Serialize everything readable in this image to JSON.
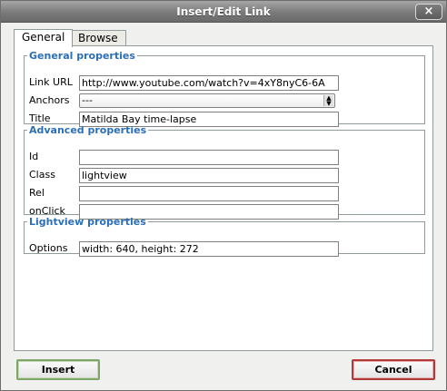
{
  "window": {
    "title": "Insert/Edit Link",
    "close_icon": "×"
  },
  "tabs": [
    {
      "label": "General",
      "active": true
    },
    {
      "label": "Browse",
      "active": false
    }
  ],
  "general": {
    "legend": "General properties",
    "link_url_label": "Link URL",
    "link_url_value": "http://www.youtube.com/watch?v=4xY8nyC6-6A",
    "anchors_label": "Anchors",
    "anchors_value": "---",
    "title_label": "Title",
    "title_value": "Matilda Bay time-lapse"
  },
  "advanced": {
    "legend": "Advanced properties",
    "id_label": "Id",
    "id_value": "",
    "class_label": "Class",
    "class_value": "lightview",
    "rel_label": "Rel",
    "rel_value": "",
    "onclick_label": "onClick",
    "onclick_value": ""
  },
  "lightview": {
    "legend": "Lightview properties",
    "options_label": "Options",
    "options_value": "width: 640, height: 272"
  },
  "buttons": {
    "insert": "Insert",
    "cancel": "Cancel"
  }
}
